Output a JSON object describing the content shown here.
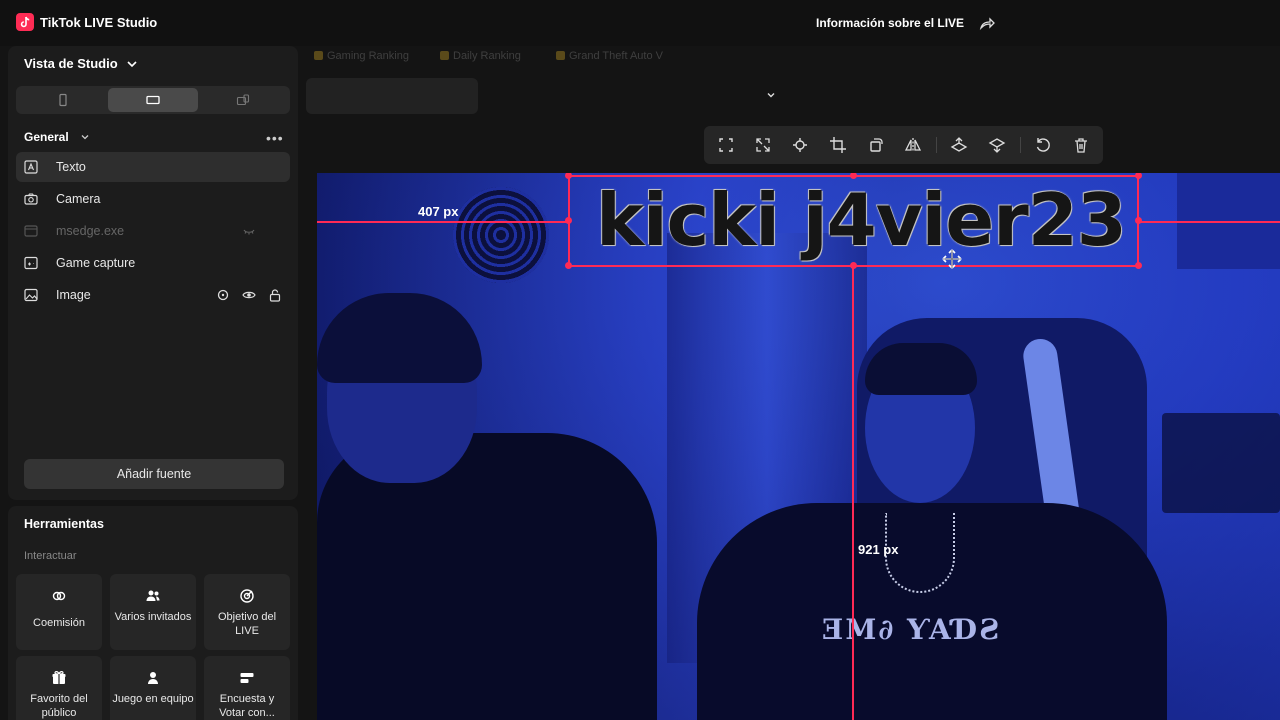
{
  "app": {
    "title": "TikTok LIVE Studio",
    "live_info": "Información sobre el LIVE"
  },
  "sidebar": {
    "studio_view_label": "Vista de Studio",
    "section_label": "General",
    "sources": [
      {
        "label": "Texto",
        "icon": "text-icon",
        "selected": true
      },
      {
        "label": "Camera",
        "icon": "camera-icon"
      },
      {
        "label": "msedge.exe",
        "icon": "window-icon",
        "disabled": true
      },
      {
        "label": "Game capture",
        "icon": "gamepad-icon"
      },
      {
        "label": "Image",
        "icon": "image-icon"
      }
    ],
    "add_source_label": "Añadir fuente",
    "tools_title": "Herramientas",
    "interact_label": "Interactuar",
    "tools": [
      {
        "label": "Coemisión",
        "icon": "link-icon"
      },
      {
        "label": "Varios invitados",
        "icon": "guests-icon"
      },
      {
        "label": "Objetivo del LIVE",
        "icon": "target-icon"
      },
      {
        "label": "Favorito del público",
        "icon": "gift-icon"
      },
      {
        "label": "Juego en equipo",
        "icon": "team-icon"
      },
      {
        "label": "Encuesta y Votar con...",
        "icon": "poll-icon"
      }
    ]
  },
  "scene_tabs": [
    "Gaming Ranking",
    "Daily Ranking",
    "Grand Theft Auto V"
  ],
  "preview": {
    "overlay_text": "kicki j4vier23",
    "hoodie_text": "ƎM∂ ƳAƊƧ",
    "measure_horizontal": "407 px",
    "measure_vertical": "921 px"
  },
  "colors": {
    "accent": "#fe2c55",
    "guide": "#ff2a55",
    "panel": "#1c1c1c"
  }
}
